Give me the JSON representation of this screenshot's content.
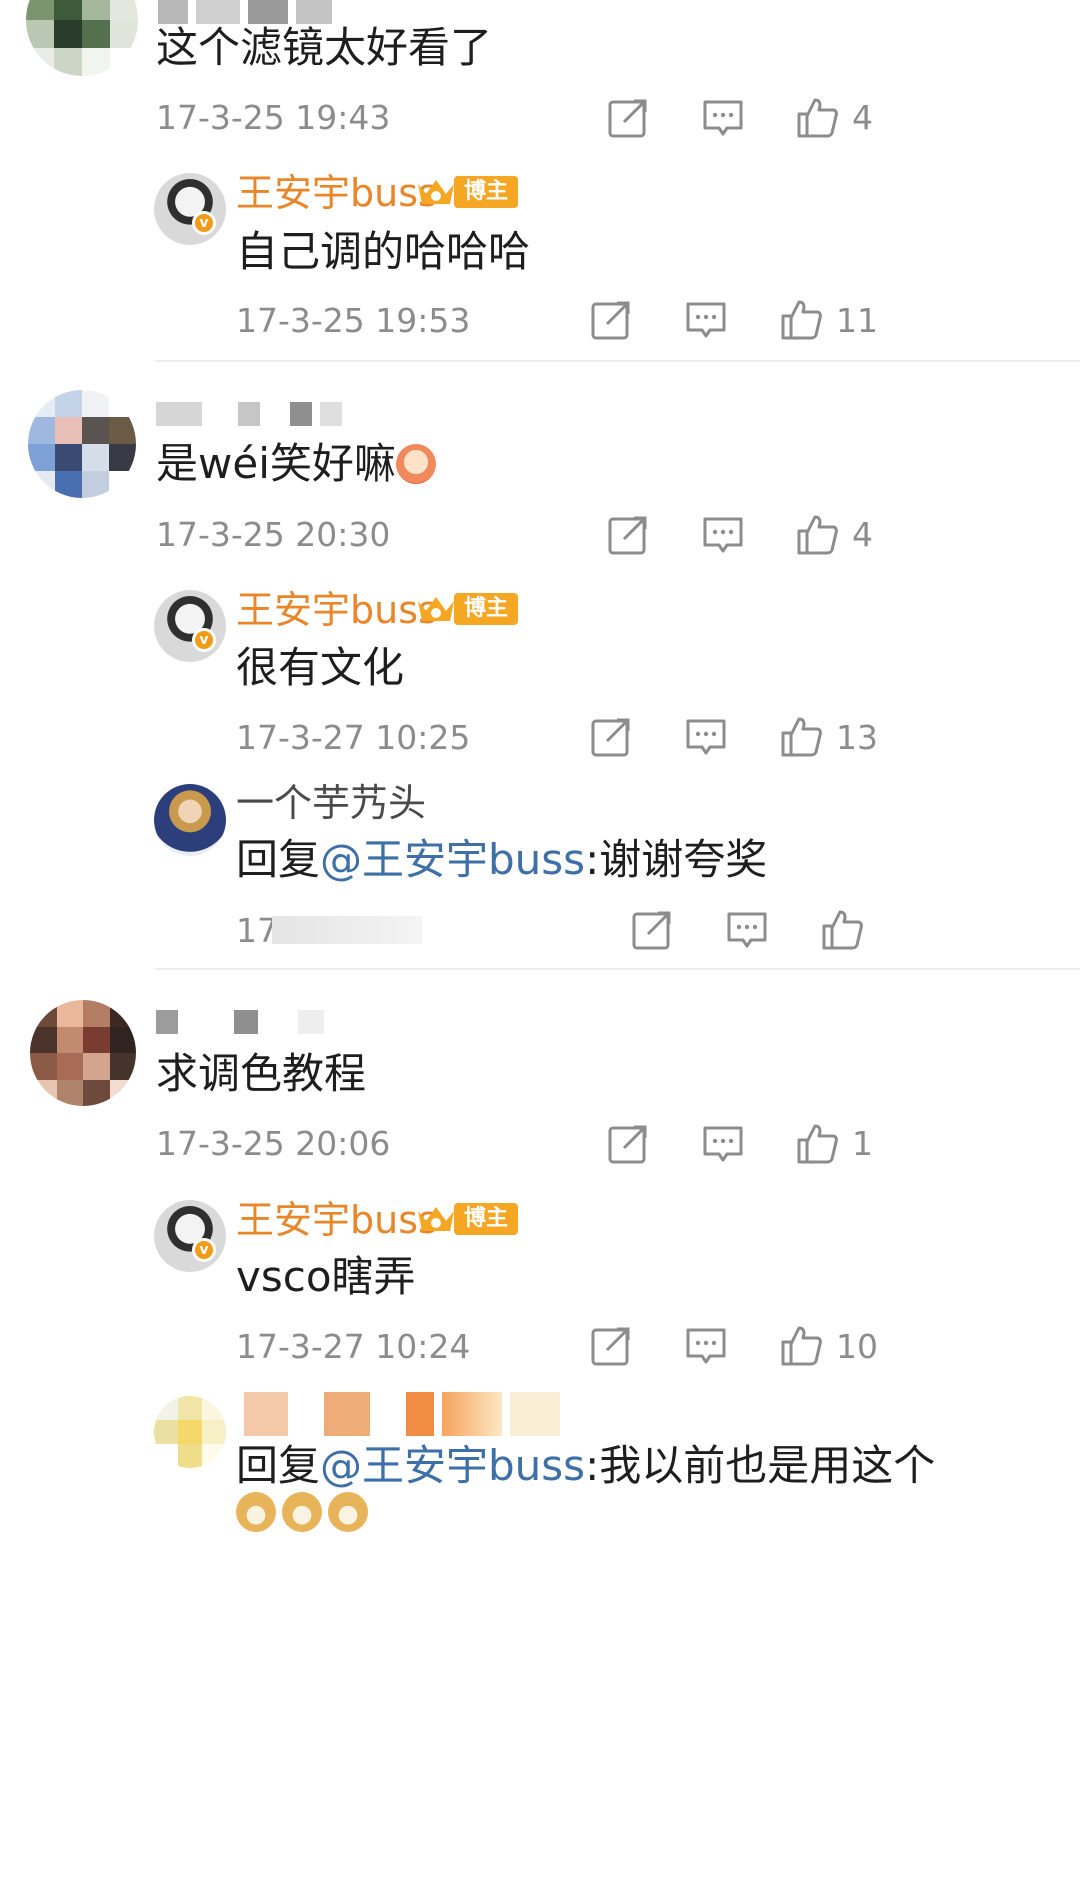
{
  "c1": {
    "text": "这个滤镜太好看了",
    "time": "17-3-25 19:43",
    "likes": "4",
    "reply": {
      "name": "王安宇buss",
      "tag": "博主",
      "text": "自己调的哈哈哈",
      "time": "17-3-25 19:53",
      "likes": "11"
    }
  },
  "c2": {
    "text": "是wéi笑好嘛",
    "time": "17-3-25 20:30",
    "likes": "4",
    "reply": {
      "name": "王安宇buss",
      "tag": "博主",
      "text": "很有文化",
      "time": "17-3-27 10:25",
      "likes": "13"
    },
    "reply2": {
      "name": "一个芋艿头",
      "prefix": "回复",
      "mention": "@王安宇buss",
      "text": ":谢谢夸奖",
      "time": "17"
    }
  },
  "c3": {
    "text": "求调色教程",
    "time": "17-3-25 20:06",
    "likes": "1",
    "reply": {
      "name": "王安宇buss",
      "tag": "博主",
      "text": "vsco瞎弄",
      "time": "17-3-27 10:24",
      "likes": "10"
    },
    "reply2": {
      "prefix": "回复",
      "mention": "@王安宇buss",
      "text": ":我以前也是用这个"
    }
  },
  "icons": [
    "forward-icon",
    "comment-icon",
    "like-icon"
  ],
  "colors": {
    "name_orange": "#e8862a",
    "mention_blue": "#3e6fa6",
    "badge_orange": "#f5a623",
    "timestamp": "#8c8c8c"
  }
}
